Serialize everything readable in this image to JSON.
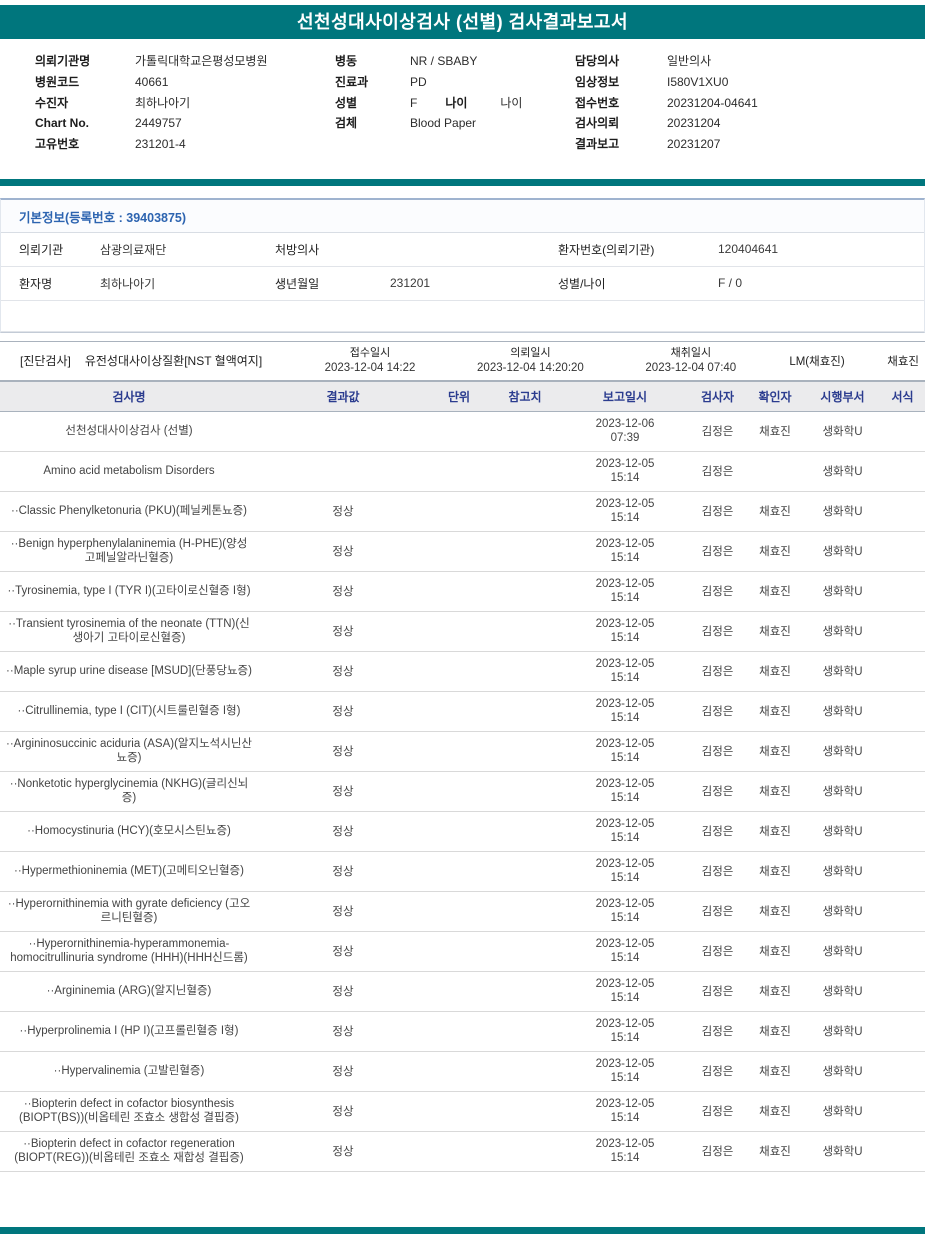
{
  "title": "선천성대사이상검사 (선별) 검사결과보고서",
  "header_columns": [
    {
      "rows": [
        {
          "label": "의뢰기관명",
          "value": "가톨릭대학교은평성모병원"
        },
        {
          "label": "병원코드",
          "value": "40661"
        },
        {
          "label": "수진자",
          "value": "최하나아기"
        },
        {
          "label": "Chart No.",
          "value": "2449757"
        },
        {
          "label": "고유번호",
          "value": "231201-4"
        }
      ]
    },
    {
      "rows": [
        {
          "label": "병동",
          "value": "NR / SBABY"
        },
        {
          "label": "진료과",
          "value": "PD"
        },
        {
          "label": "성별",
          "value": "F",
          "label2": "나이",
          "value2": "나이"
        },
        {
          "label": "검체",
          "value": "Blood Paper"
        }
      ]
    },
    {
      "rows": [
        {
          "label": "담당의사",
          "value": "일반의사"
        },
        {
          "label": "임상정보",
          "value": "I580V1XU0"
        },
        {
          "label": "접수번호",
          "value": "20231204-04641"
        },
        {
          "label": "검사의뢰",
          "value": "20231204"
        },
        {
          "label": "결과보고",
          "value": "20231207"
        }
      ]
    }
  ],
  "basic_info": {
    "title": "기본정보(등록번호 : 39403875)",
    "rows": [
      [
        {
          "label": "의뢰기관",
          "value": "삼광의료재단"
        },
        {
          "label": "처방의사",
          "value": ""
        },
        {
          "label": "환자번호(의뢰기관)",
          "value": "120404641"
        }
      ],
      [
        {
          "label": "환자명",
          "value": "최하나아기"
        },
        {
          "label": "생년월일",
          "value": "231201"
        },
        {
          "label": "성별/나이",
          "value": "F / 0"
        }
      ]
    ]
  },
  "diagnosis": {
    "tag": "[진단검사]",
    "test_name": "유전성대사이상질환[NST 혈액여지]",
    "times": [
      {
        "label": "접수일시",
        "value": "2023-12-04 14:22"
      },
      {
        "label": "의뢰일시",
        "value": "2023-12-04 14:20:20"
      },
      {
        "label": "채취일시",
        "value": "2023-12-04 07:40"
      }
    ],
    "lm": "LM(채효진)",
    "collector": "채효진"
  },
  "results": {
    "columns": [
      "검사명",
      "결과값",
      "단위",
      "참고치",
      "보고일시",
      "검사자",
      "확인자",
      "시행부서",
      "서식"
    ],
    "rows": [
      {
        "name": "선천성대사이상검사 (선별)",
        "result": "",
        "unit": "",
        "ref": "",
        "reported": "2023-12-06 07:39",
        "tester": "김정은",
        "confirmer": "채효진",
        "dept": "생화학U",
        "format": ""
      },
      {
        "name": "Amino acid metabolism Disorders",
        "result": "",
        "unit": "",
        "ref": "",
        "reported": "2023-12-05 15:14",
        "tester": "김정은",
        "confirmer": "",
        "dept": "생화학U",
        "format": ""
      },
      {
        "name": "··Classic Phenylketonuria (PKU)(페닐케톤뇨증)",
        "result": "정상",
        "unit": "",
        "ref": "",
        "reported": "2023-12-05 15:14",
        "tester": "김정은",
        "confirmer": "채효진",
        "dept": "생화학U",
        "format": ""
      },
      {
        "name": "··Benign hyperphenylalaninemia (H-PHE)(양성 고페닐알라닌혈증)",
        "result": "정상",
        "unit": "",
        "ref": "",
        "reported": "2023-12-05 15:14",
        "tester": "김정은",
        "confirmer": "채효진",
        "dept": "생화학U",
        "format": ""
      },
      {
        "name": "··Tyrosinemia, type I (TYR I)(고타이로신혈증 I형)",
        "result": "정상",
        "unit": "",
        "ref": "",
        "reported": "2023-12-05 15:14",
        "tester": "김정은",
        "confirmer": "채효진",
        "dept": "생화학U",
        "format": ""
      },
      {
        "name": "··Transient tyrosinemia of the neonate (TTN)(신생아기 고타이로신혈증)",
        "result": "정상",
        "unit": "",
        "ref": "",
        "reported": "2023-12-05 15:14",
        "tester": "김정은",
        "confirmer": "채효진",
        "dept": "생화학U",
        "format": ""
      },
      {
        "name": "··Maple syrup urine disease [MSUD](단풍당뇨증)",
        "result": "정상",
        "unit": "",
        "ref": "",
        "reported": "2023-12-05 15:14",
        "tester": "김정은",
        "confirmer": "채효진",
        "dept": "생화학U",
        "format": ""
      },
      {
        "name": "··Citrullinemia, type I (CIT)(시트룰린혈증 I형)",
        "result": "정상",
        "unit": "",
        "ref": "",
        "reported": "2023-12-05 15:14",
        "tester": "김정은",
        "confirmer": "채효진",
        "dept": "생화학U",
        "format": ""
      },
      {
        "name": "··Argininosuccinic aciduria (ASA)(알지노석시닌산뇨증)",
        "result": "정상",
        "unit": "",
        "ref": "",
        "reported": "2023-12-05 15:14",
        "tester": "김정은",
        "confirmer": "채효진",
        "dept": "생화학U",
        "format": ""
      },
      {
        "name": "··Nonketotic hyperglycinemia (NKHG)(글리신뇌증)",
        "result": "정상",
        "unit": "",
        "ref": "",
        "reported": "2023-12-05 15:14",
        "tester": "김정은",
        "confirmer": "채효진",
        "dept": "생화학U",
        "format": ""
      },
      {
        "name": "··Homocystinuria (HCY)(호모시스틴뇨증)",
        "result": "정상",
        "unit": "",
        "ref": "",
        "reported": "2023-12-05 15:14",
        "tester": "김정은",
        "confirmer": "채효진",
        "dept": "생화학U",
        "format": ""
      },
      {
        "name": "··Hypermethioninemia (MET)(고메티오닌혈증)",
        "result": "정상",
        "unit": "",
        "ref": "",
        "reported": "2023-12-05 15:14",
        "tester": "김정은",
        "confirmer": "채효진",
        "dept": "생화학U",
        "format": ""
      },
      {
        "name": "··Hyperornithinemia with gyrate deficiency (고오르니틴혈증)",
        "result": "정상",
        "unit": "",
        "ref": "",
        "reported": "2023-12-05 15:14",
        "tester": "김정은",
        "confirmer": "채효진",
        "dept": "생화학U",
        "format": ""
      },
      {
        "name": "··Hyperornithinemia-hyperammonemia-homocitrullinuria syndrome (HHH)(HHH신드롬)",
        "result": "정상",
        "unit": "",
        "ref": "",
        "reported": "2023-12-05 15:14",
        "tester": "김정은",
        "confirmer": "채효진",
        "dept": "생화학U",
        "format": ""
      },
      {
        "name": "··Argininemia (ARG)(알지닌혈증)",
        "result": "정상",
        "unit": "",
        "ref": "",
        "reported": "2023-12-05 15:14",
        "tester": "김정은",
        "confirmer": "채효진",
        "dept": "생화학U",
        "format": ""
      },
      {
        "name": "··Hyperprolinemia I (HP I)(고프롤린혈증 I형)",
        "result": "정상",
        "unit": "",
        "ref": "",
        "reported": "2023-12-05 15:14",
        "tester": "김정은",
        "confirmer": "채효진",
        "dept": "생화학U",
        "format": ""
      },
      {
        "name": "··Hypervalinemia (고발린혈증)",
        "result": "정상",
        "unit": "",
        "ref": "",
        "reported": "2023-12-05 15:14",
        "tester": "김정은",
        "confirmer": "채효진",
        "dept": "생화학U",
        "format": ""
      },
      {
        "name": "··Biopterin defect in cofactor biosynthesis (BIOPT(BS))(비옵테린 조효소 생합성 결핍증)",
        "result": "정상",
        "unit": "",
        "ref": "",
        "reported": "2023-12-05 15:14",
        "tester": "김정은",
        "confirmer": "채효진",
        "dept": "생화학U",
        "format": ""
      },
      {
        "name": "··Biopterin defect in cofactor regeneration (BIOPT(REG))(비옵테린 조효소 재합성 결핍증)",
        "result": "정상",
        "unit": "",
        "ref": "",
        "reported": "2023-12-05 15:14",
        "tester": "김정은",
        "confirmer": "채효진",
        "dept": "생화학U",
        "format": ""
      }
    ]
  },
  "colors": {
    "teal": "#00767D",
    "table_header_text": "#2B3C8F",
    "info_title_text": "#2D64B0"
  }
}
